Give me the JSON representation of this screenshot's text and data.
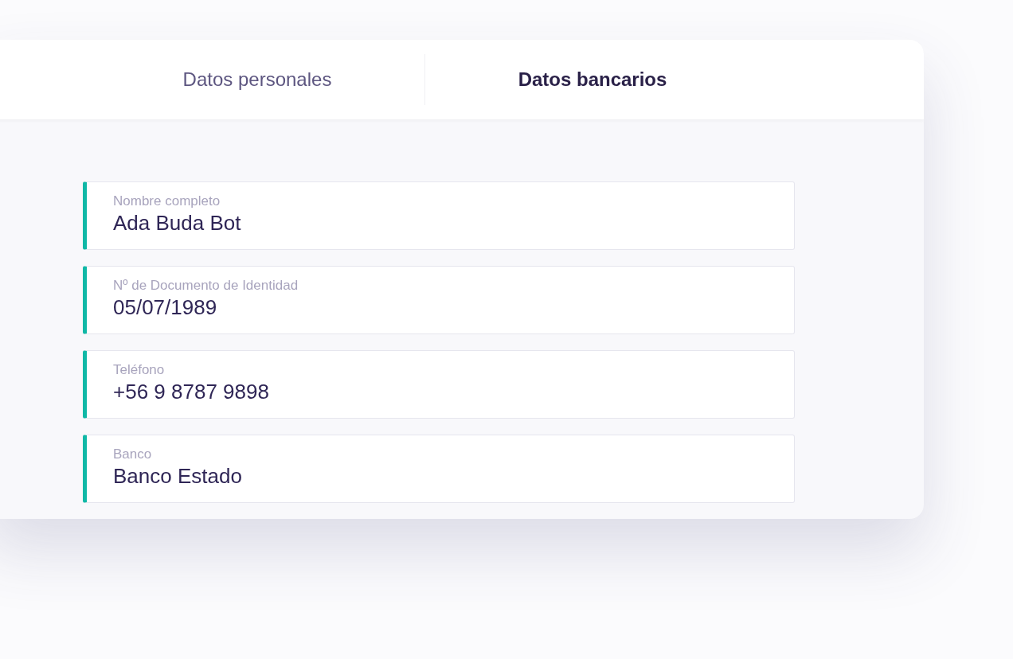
{
  "tabs": [
    {
      "label": "Datos personales",
      "selected": false
    },
    {
      "label": "Datos bancarios",
      "selected": true
    }
  ],
  "fields": [
    {
      "label": "Nombre completo",
      "value": "Ada Buda Bot"
    },
    {
      "label": "Nº de Documento de Identidad",
      "value": "05/07/1989"
    },
    {
      "label": "Teléfono",
      "value": "+56 9 8787 9898"
    },
    {
      "label": "Banco",
      "value": "Banco Estado"
    }
  ]
}
